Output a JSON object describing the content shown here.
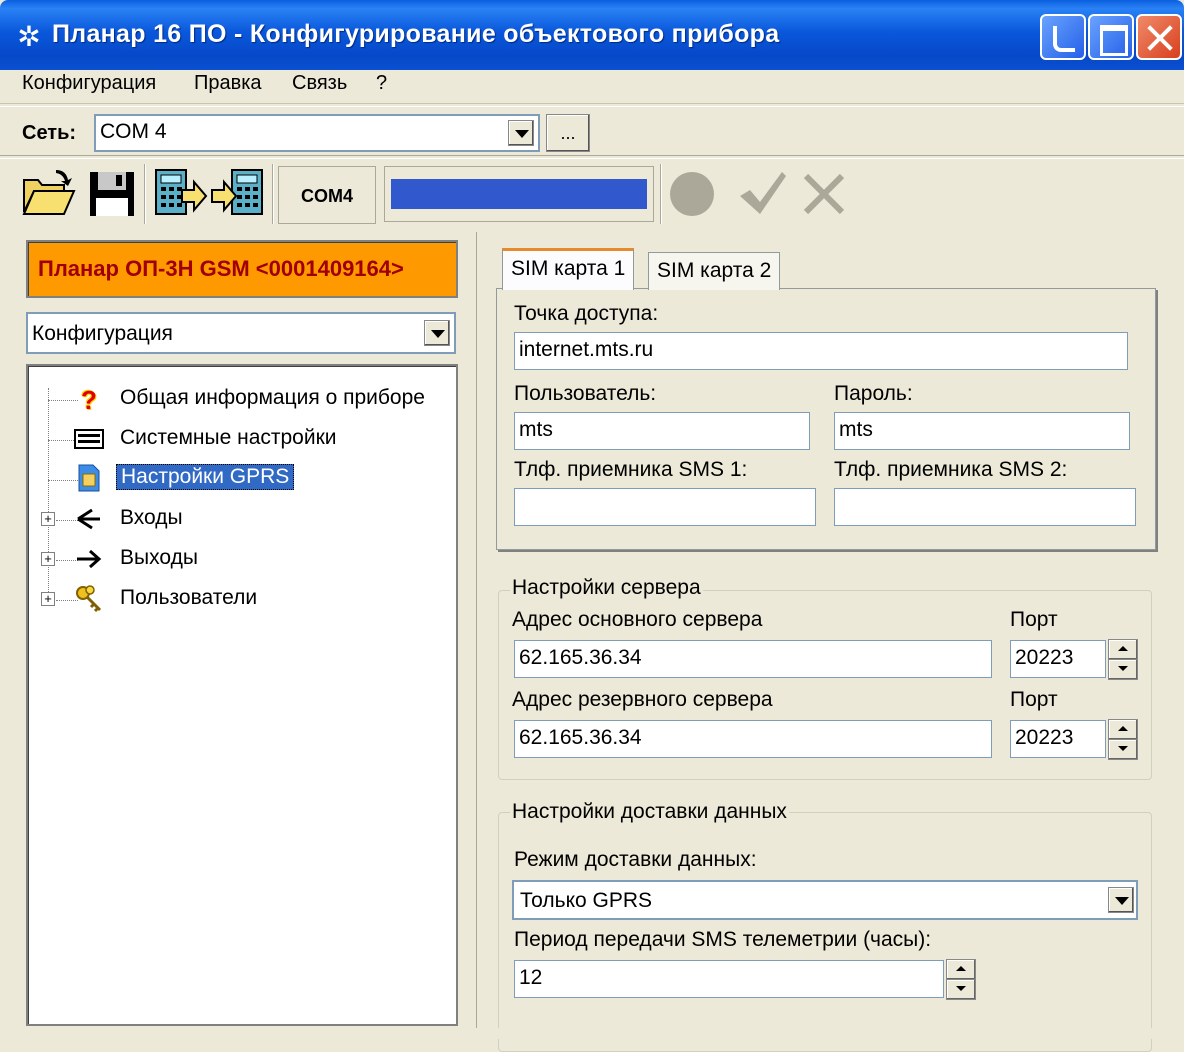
{
  "window": {
    "title": "Планар 16 ПО - Конфигурирование объектового прибора"
  },
  "menu": {
    "items": [
      "Конфигурация",
      "Правка",
      "Связь",
      "?"
    ]
  },
  "network": {
    "label": "Сеть:",
    "value": "COM 4",
    "browse_label": "..."
  },
  "toolbar": {
    "com_label": "COM4",
    "progress": 1.0
  },
  "device": {
    "title": "Планар ОП-3Н GSM <0001409164>"
  },
  "view_select": {
    "value": "Конфигурация"
  },
  "tree": {
    "items": [
      {
        "label": "Общая информация о приборе",
        "icon": "question-icon"
      },
      {
        "label": "Системные настройки",
        "icon": "keyboard-icon"
      },
      {
        "label": "Настройки GPRS",
        "icon": "sim-card-icon",
        "selected": true
      },
      {
        "label": "Входы",
        "icon": "input-icon",
        "expandable": true
      },
      {
        "label": "Выходы",
        "icon": "arrow-right-icon",
        "expandable": true
      },
      {
        "label": "Пользователи",
        "icon": "keys-icon",
        "expandable": true
      }
    ]
  },
  "sim_tabs": {
    "tabs": [
      "SIM карта 1",
      "SIM карта 2"
    ],
    "active": 0,
    "access_point_label": "Точка доступа:",
    "access_point": "internet.mts.ru",
    "user_label": "Пользователь:",
    "user": "mts",
    "password_label": "Пароль:",
    "password": "mts",
    "sms1_label": "Тлф. приемника SMS 1:",
    "sms1": "",
    "sms2_label": "Тлф. приемника SMS 2:",
    "sms2": ""
  },
  "server": {
    "title": "Настройки сервера",
    "main_label": "Адрес основного сервера",
    "main_address": "62.165.36.34",
    "port_label": "Порт",
    "main_port": "20223",
    "backup_label": "Адрес резервного сервера",
    "backup_address": "62.165.36.34",
    "backup_port": "20223"
  },
  "delivery": {
    "title": "Настройки доставки данных",
    "mode_label": "Режим доставки данных:",
    "mode": "Только GPRS",
    "period_label": "Период передачи SMS телеметрии (часы):",
    "period": "12"
  },
  "colors": {
    "titlebar": "#0a58dc",
    "device_bg": "#ff9900",
    "device_text": "#a00000",
    "selection": "#316ac5",
    "progress": "#3158cd"
  }
}
